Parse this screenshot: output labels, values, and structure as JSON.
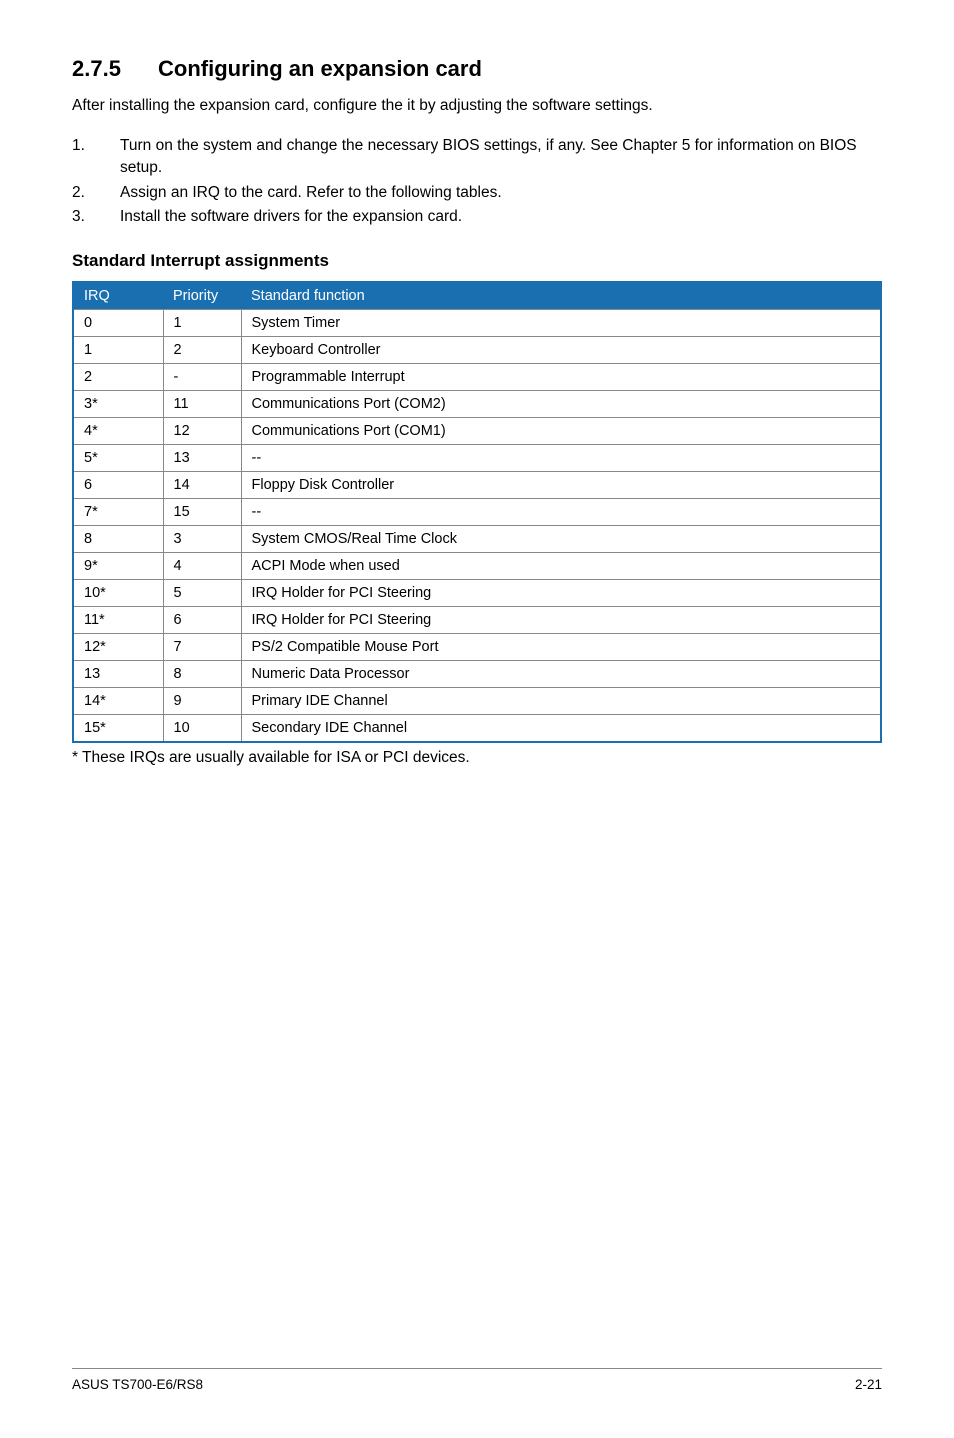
{
  "heading": {
    "number": "2.7.5",
    "title": "Configuring an expansion card"
  },
  "intro": "After installing the expansion card, configure the it by adjusting the software settings.",
  "steps": [
    "Turn on the system and change the necessary BIOS settings, if any. See Chapter 5 for information on BIOS setup.",
    "Assign an IRQ to the card. Refer to the following tables.",
    "Install the software drivers for the expansion card."
  ],
  "subheading": "Standard Interrupt assignments",
  "table": {
    "headers": {
      "irq": "IRQ",
      "priority": "Priority",
      "func": "Standard function"
    },
    "rows": [
      {
        "irq": "0",
        "priority": "1",
        "func": "System Timer"
      },
      {
        "irq": "1",
        "priority": "2",
        "func": "Keyboard Controller"
      },
      {
        "irq": "2",
        "priority": "-",
        "func": "Programmable Interrupt"
      },
      {
        "irq": "3*",
        "priority": "11",
        "func": "Communications Port (COM2)"
      },
      {
        "irq": "4*",
        "priority": "12",
        "func": "Communications Port (COM1)"
      },
      {
        "irq": "5*",
        "priority": "13",
        "func": "--"
      },
      {
        "irq": "6",
        "priority": "14",
        "func": "Floppy Disk Controller"
      },
      {
        "irq": "7*",
        "priority": "15",
        "func": "--"
      },
      {
        "irq": "8",
        "priority": "3",
        "func": "System CMOS/Real Time Clock"
      },
      {
        "irq": "9*",
        "priority": "4",
        "func": "ACPI Mode when used"
      },
      {
        "irq": "10*",
        "priority": "5",
        "func": "IRQ Holder for PCI Steering"
      },
      {
        "irq": "11*",
        "priority": "6",
        "func": "IRQ Holder for PCI Steering"
      },
      {
        "irq": "12*",
        "priority": "7",
        "func": "PS/2 Compatible Mouse Port"
      },
      {
        "irq": "13",
        "priority": "8",
        "func": "Numeric Data Processor"
      },
      {
        "irq": "14*",
        "priority": "9",
        "func": "Primary IDE Channel"
      },
      {
        "irq": "15*",
        "priority": "10",
        "func": "Secondary IDE Channel"
      }
    ]
  },
  "footnote": "* These IRQs are usually available for ISA or PCI devices.",
  "footer": {
    "left": "ASUS TS700-E6/RS8",
    "right": "2-21"
  }
}
